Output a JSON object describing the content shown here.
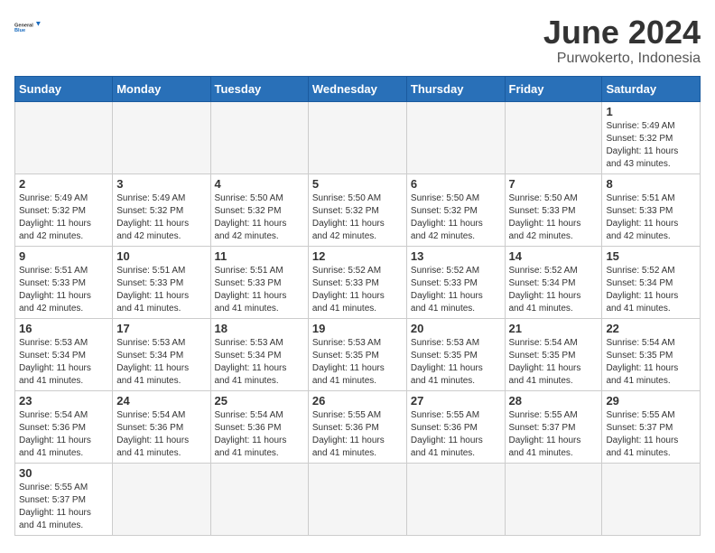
{
  "header": {
    "logo_general": "General",
    "logo_blue": "Blue",
    "month_title": "June 2024",
    "subtitle": "Purwokerto, Indonesia"
  },
  "days_of_week": [
    "Sunday",
    "Monday",
    "Tuesday",
    "Wednesday",
    "Thursday",
    "Friday",
    "Saturday"
  ],
  "week1": [
    {
      "day": "",
      "info": ""
    },
    {
      "day": "",
      "info": ""
    },
    {
      "day": "",
      "info": ""
    },
    {
      "day": "",
      "info": ""
    },
    {
      "day": "",
      "info": ""
    },
    {
      "day": "",
      "info": ""
    },
    {
      "day": "1",
      "info": "Sunrise: 5:49 AM\nSunset: 5:32 PM\nDaylight: 11 hours\nand 43 minutes."
    }
  ],
  "week2": [
    {
      "day": "2",
      "info": "Sunrise: 5:49 AM\nSunset: 5:32 PM\nDaylight: 11 hours\nand 42 minutes."
    },
    {
      "day": "3",
      "info": "Sunrise: 5:49 AM\nSunset: 5:32 PM\nDaylight: 11 hours\nand 42 minutes."
    },
    {
      "day": "4",
      "info": "Sunrise: 5:50 AM\nSunset: 5:32 PM\nDaylight: 11 hours\nand 42 minutes."
    },
    {
      "day": "5",
      "info": "Sunrise: 5:50 AM\nSunset: 5:32 PM\nDaylight: 11 hours\nand 42 minutes."
    },
    {
      "day": "6",
      "info": "Sunrise: 5:50 AM\nSunset: 5:32 PM\nDaylight: 11 hours\nand 42 minutes."
    },
    {
      "day": "7",
      "info": "Sunrise: 5:50 AM\nSunset: 5:33 PM\nDaylight: 11 hours\nand 42 minutes."
    },
    {
      "day": "8",
      "info": "Sunrise: 5:51 AM\nSunset: 5:33 PM\nDaylight: 11 hours\nand 42 minutes."
    }
  ],
  "week3": [
    {
      "day": "9",
      "info": "Sunrise: 5:51 AM\nSunset: 5:33 PM\nDaylight: 11 hours\nand 42 minutes."
    },
    {
      "day": "10",
      "info": "Sunrise: 5:51 AM\nSunset: 5:33 PM\nDaylight: 11 hours\nand 41 minutes."
    },
    {
      "day": "11",
      "info": "Sunrise: 5:51 AM\nSunset: 5:33 PM\nDaylight: 11 hours\nand 41 minutes."
    },
    {
      "day": "12",
      "info": "Sunrise: 5:52 AM\nSunset: 5:33 PM\nDaylight: 11 hours\nand 41 minutes."
    },
    {
      "day": "13",
      "info": "Sunrise: 5:52 AM\nSunset: 5:33 PM\nDaylight: 11 hours\nand 41 minutes."
    },
    {
      "day": "14",
      "info": "Sunrise: 5:52 AM\nSunset: 5:34 PM\nDaylight: 11 hours\nand 41 minutes."
    },
    {
      "day": "15",
      "info": "Sunrise: 5:52 AM\nSunset: 5:34 PM\nDaylight: 11 hours\nand 41 minutes."
    }
  ],
  "week4": [
    {
      "day": "16",
      "info": "Sunrise: 5:53 AM\nSunset: 5:34 PM\nDaylight: 11 hours\nand 41 minutes."
    },
    {
      "day": "17",
      "info": "Sunrise: 5:53 AM\nSunset: 5:34 PM\nDaylight: 11 hours\nand 41 minutes."
    },
    {
      "day": "18",
      "info": "Sunrise: 5:53 AM\nSunset: 5:34 PM\nDaylight: 11 hours\nand 41 minutes."
    },
    {
      "day": "19",
      "info": "Sunrise: 5:53 AM\nSunset: 5:35 PM\nDaylight: 11 hours\nand 41 minutes."
    },
    {
      "day": "20",
      "info": "Sunrise: 5:53 AM\nSunset: 5:35 PM\nDaylight: 11 hours\nand 41 minutes."
    },
    {
      "day": "21",
      "info": "Sunrise: 5:54 AM\nSunset: 5:35 PM\nDaylight: 11 hours\nand 41 minutes."
    },
    {
      "day": "22",
      "info": "Sunrise: 5:54 AM\nSunset: 5:35 PM\nDaylight: 11 hours\nand 41 minutes."
    }
  ],
  "week5": [
    {
      "day": "23",
      "info": "Sunrise: 5:54 AM\nSunset: 5:36 PM\nDaylight: 11 hours\nand 41 minutes."
    },
    {
      "day": "24",
      "info": "Sunrise: 5:54 AM\nSunset: 5:36 PM\nDaylight: 11 hours\nand 41 minutes."
    },
    {
      "day": "25",
      "info": "Sunrise: 5:54 AM\nSunset: 5:36 PM\nDaylight: 11 hours\nand 41 minutes."
    },
    {
      "day": "26",
      "info": "Sunrise: 5:55 AM\nSunset: 5:36 PM\nDaylight: 11 hours\nand 41 minutes."
    },
    {
      "day": "27",
      "info": "Sunrise: 5:55 AM\nSunset: 5:36 PM\nDaylight: 11 hours\nand 41 minutes."
    },
    {
      "day": "28",
      "info": "Sunrise: 5:55 AM\nSunset: 5:37 PM\nDaylight: 11 hours\nand 41 minutes."
    },
    {
      "day": "29",
      "info": "Sunrise: 5:55 AM\nSunset: 5:37 PM\nDaylight: 11 hours\nand 41 minutes."
    }
  ],
  "week6": [
    {
      "day": "30",
      "info": "Sunrise: 5:55 AM\nSunset: 5:37 PM\nDaylight: 11 hours\nand 41 minutes."
    },
    {
      "day": "",
      "info": ""
    },
    {
      "day": "",
      "info": ""
    },
    {
      "day": "",
      "info": ""
    },
    {
      "day": "",
      "info": ""
    },
    {
      "day": "",
      "info": ""
    },
    {
      "day": "",
      "info": ""
    }
  ]
}
